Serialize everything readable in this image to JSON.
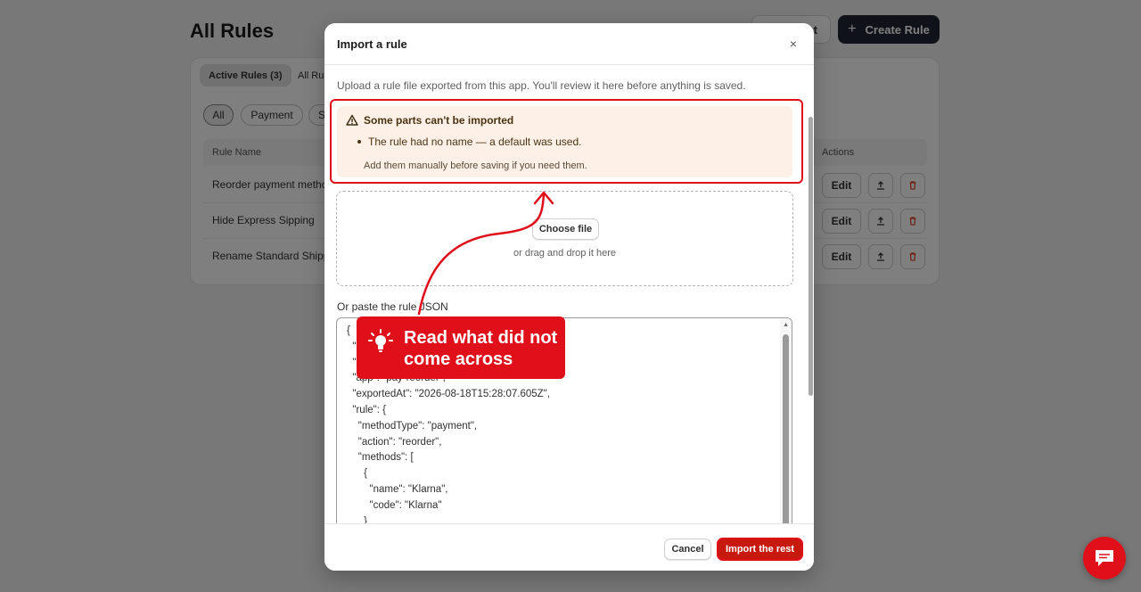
{
  "background": {
    "page_title": "All Rules",
    "header_secondary_label": "t",
    "header_primary_label": "Create Rule",
    "tabs": [
      "Active Rules (3)",
      "All Ru"
    ],
    "chips": [
      "All",
      "Payment",
      "S"
    ],
    "columns": {
      "rule_name": "Rule Name",
      "actions": "Actions"
    },
    "rows": [
      {
        "name": "Reorder payment metho",
        "edit": "Edit"
      },
      {
        "name": "Hide Express Sipping",
        "edit": "Edit"
      },
      {
        "name": "Rename Standard Shipp",
        "edit": "Edit"
      }
    ]
  },
  "modal": {
    "title": "Import a rule",
    "close_icon": "×",
    "description": "Upload a rule file exported from this app. You'll review it here before anything is saved.",
    "warning": {
      "title": "Some parts can't be imported",
      "bullet": "The rule had no name — a default was used.",
      "note": "Add them manually before saving if you need them."
    },
    "dropzone": {
      "button": "Choose file",
      "hint": "or drag and drop it here"
    },
    "paste_label": "Or paste the rule JSON",
    "json_lines": [
      "{",
      "  \"",
      "  \"",
      "  \"app\": \"pay-reorder\",",
      "  \"exportedAt\": \"2026-08-18T15:28:07.605Z\",",
      "  \"rule\": {",
      "    \"methodType\": \"payment\",",
      "    \"action\": \"reorder\",",
      "    \"methods\": [",
      "      {",
      "        \"name\": \"Klarna\",",
      "        \"code\": \"Klarna\"",
      "      }"
    ],
    "cancel_label": "Cancel",
    "import_label": "Import the rest"
  },
  "annotation": {
    "text": "Read what did not come across",
    "color": "#e0101a"
  },
  "icons": {
    "plus": "plus-icon",
    "upload": "upload-icon",
    "trash": "trash-icon",
    "warning": "warning-triangle-icon",
    "lightbulb": "lightbulb-icon",
    "chat": "chat-icon"
  }
}
